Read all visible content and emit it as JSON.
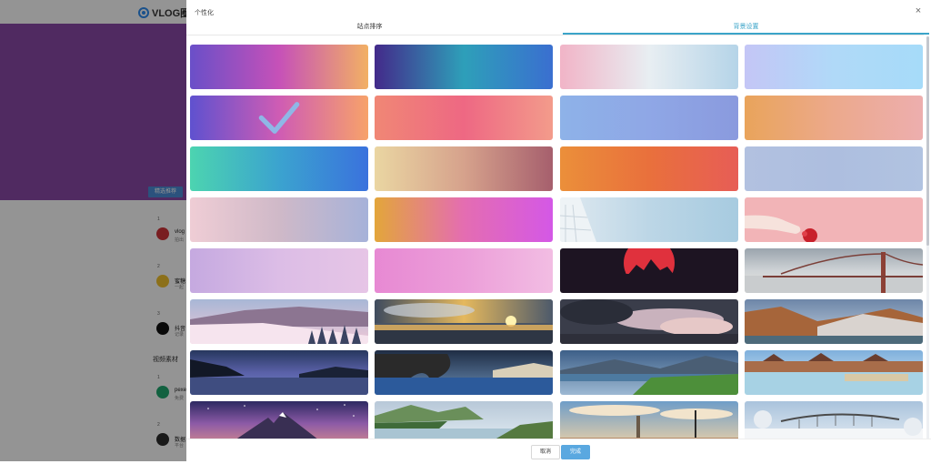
{
  "app": {
    "logo_text": "VLOG圈",
    "bg_button": "精选推荐",
    "bg_section_title": "视频素材",
    "bg_items": [
      {
        "rank": "1",
        "name": "vlog",
        "sub": "拍出",
        "color": "#d0353a"
      },
      {
        "rank": "2",
        "name": "蜜糖",
        "sub": "一起",
        "color": "#f2c12e"
      },
      {
        "rank": "3",
        "name": "抖音",
        "sub": "记录",
        "color": "#111111"
      }
    ],
    "bg_items2": [
      {
        "rank": "1",
        "name": "pexe",
        "sub": "免费",
        "color": "#1fa76f"
      },
      {
        "rank": "2",
        "name": "数据",
        "sub": "平台",
        "color": "#2b2b2b"
      }
    ]
  },
  "modal": {
    "title": "个性化",
    "close_label": "×",
    "tabs": [
      {
        "label": "站点排序",
        "active": false
      },
      {
        "label": "背景设置",
        "active": true
      }
    ],
    "selected_index": 4,
    "cancel_label": "取消",
    "ok_label": "完成"
  },
  "tiles": [
    {
      "kind": "gradient",
      "angle": 90,
      "stops": [
        "#6a4fc8",
        "#c651b8",
        "#f2b064"
      ]
    },
    {
      "kind": "gradient",
      "angle": 90,
      "stops": [
        "#432a8a",
        "#2e9fb9",
        "#3a6fd0"
      ]
    },
    {
      "kind": "gradient",
      "angle": 120,
      "stops": [
        "#f1b4c7",
        "#e8eef2",
        "#b5d4e8"
      ]
    },
    {
      "kind": "gradient",
      "angle": 90,
      "stops": [
        "#c4c6f6",
        "#b0d9f8",
        "#a6dbf9"
      ]
    },
    {
      "kind": "gradient",
      "angle": 90,
      "stops": [
        "#5f51cf",
        "#cf5cb4",
        "#f7a26a"
      ]
    },
    {
      "kind": "gradient",
      "angle": 90,
      "stops": [
        "#f08775",
        "#ee6883",
        "#f39b8b"
      ]
    },
    {
      "kind": "gradient",
      "angle": 90,
      "stops": [
        "#8eb2e8",
        "#8fa7e6",
        "#8a9ade"
      ]
    },
    {
      "kind": "gradient",
      "angle": 90,
      "stops": [
        "#e9a45b",
        "#eca98c",
        "#edaeae"
      ]
    },
    {
      "kind": "gradient",
      "angle": 90,
      "stops": [
        "#4cd4b0",
        "#3ba3cf",
        "#3a72dd"
      ]
    },
    {
      "kind": "gradient",
      "angle": 90,
      "stops": [
        "#ead6a2",
        "#d6a28c",
        "#a65f6d"
      ]
    },
    {
      "kind": "gradient",
      "angle": 90,
      "stops": [
        "#eb8f3a",
        "#e9703c",
        "#e75d56"
      ]
    },
    {
      "kind": "gradient",
      "angle": 90,
      "stops": [
        "#b2c1e0",
        "#adbedf",
        "#b1c3e1"
      ]
    },
    {
      "kind": "gradient",
      "angle": 90,
      "stops": [
        "#efcdd5",
        "#cfb9c8",
        "#a6b2d9"
      ]
    },
    {
      "kind": "gradient",
      "angle": 90,
      "stops": [
        "#e3a63a",
        "#e46db1",
        "#d458e6"
      ]
    },
    {
      "kind": "scene",
      "scene": "building-sky"
    },
    {
      "kind": "scene",
      "scene": "hand-pink"
    },
    {
      "kind": "gradient",
      "angle": 90,
      "stops": [
        "#c5a9e0",
        "#dcbde6",
        "#e6c5e6"
      ]
    },
    {
      "kind": "gradient",
      "angle": 90,
      "stops": [
        "#e789d3",
        "#ec9ed9",
        "#f2bde3"
      ]
    },
    {
      "kind": "scene",
      "scene": "red-sun"
    },
    {
      "kind": "scene",
      "scene": "bridge-fog"
    },
    {
      "kind": "scene",
      "scene": "snow-forest"
    },
    {
      "kind": "scene",
      "scene": "sunset-clouds"
    },
    {
      "kind": "scene",
      "scene": "dark-clouds"
    },
    {
      "kind": "scene",
      "scene": "canyon"
    },
    {
      "kind": "scene",
      "scene": "night-lake"
    },
    {
      "kind": "scene",
      "scene": "sea-arch"
    },
    {
      "kind": "scene",
      "scene": "green-lake"
    },
    {
      "kind": "scene",
      "scene": "resort-pool"
    },
    {
      "kind": "scene",
      "scene": "mountain-stars"
    },
    {
      "kind": "scene",
      "scene": "green-coast"
    },
    {
      "kind": "scene",
      "scene": "lighthouse"
    },
    {
      "kind": "scene",
      "scene": "winter-bridge"
    }
  ],
  "icons": {
    "close": "close-icon",
    "check": "check-icon",
    "logo": "logo-icon"
  },
  "colors": {
    "accent": "#3ba4c9",
    "ok_button": "#5aa8e0",
    "overlay": "rgba(0,0,0,0.42)"
  }
}
